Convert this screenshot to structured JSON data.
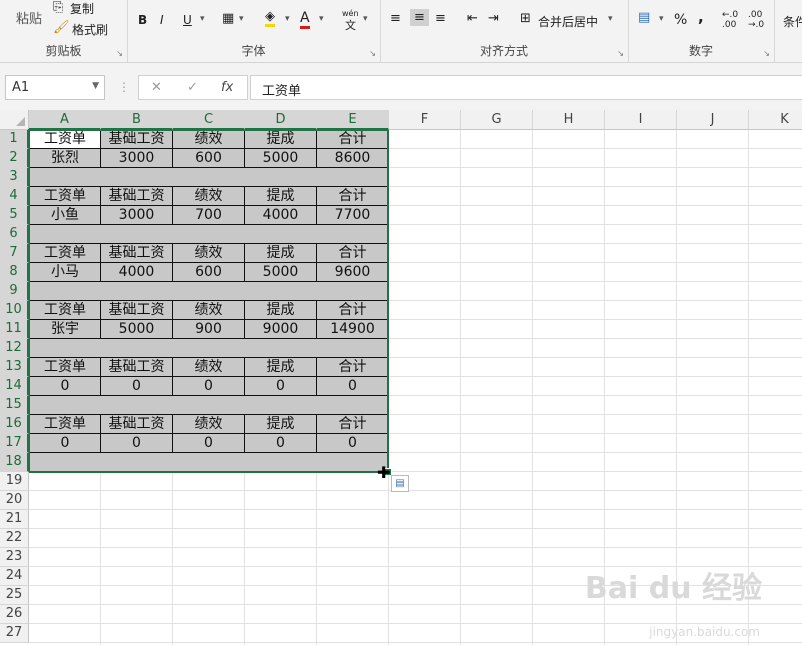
{
  "ribbon": {
    "clipboard": {
      "paste": "粘贴",
      "copy": "复制",
      "format_painter": "格式刷",
      "label": "剪贴板"
    },
    "font": {
      "bold": "B",
      "italic": "I",
      "underline": "U",
      "font_color": "A",
      "wen": "wén",
      "wen_char": "文",
      "label": "字体"
    },
    "alignment": {
      "merge_center": "合并后居中",
      "label": "对齐方式"
    },
    "number": {
      "percent": "%",
      "comma": ",",
      "label": "数字"
    },
    "styles": {
      "cond_format": "条件"
    }
  },
  "formula_bar": {
    "name_box": "A1",
    "cancel": "✕",
    "confirm": "✓",
    "fx": "fx",
    "content": "工资单"
  },
  "columns": [
    "A",
    "B",
    "C",
    "D",
    "E",
    "F",
    "G",
    "H",
    "I",
    "J",
    "K"
  ],
  "rows": [
    "1",
    "2",
    "3",
    "4",
    "5",
    "6",
    "7",
    "8",
    "9",
    "10",
    "11",
    "12",
    "13",
    "14",
    "15",
    "16",
    "17",
    "18",
    "19",
    "20",
    "21",
    "22",
    "23",
    "24",
    "25",
    "26",
    "27"
  ],
  "cells": {
    "r1": [
      "工资单",
      "基础工资",
      "绩效",
      "提成",
      "合计"
    ],
    "r2": [
      "张烈",
      "3000",
      "600",
      "5000",
      "8600"
    ],
    "r4": [
      "工资单",
      "基础工资",
      "绩效",
      "提成",
      "合计"
    ],
    "r5": [
      "小鱼",
      "3000",
      "700",
      "4000",
      "7700"
    ],
    "r7": [
      "工资单",
      "基础工资",
      "绩效",
      "提成",
      "合计"
    ],
    "r8": [
      "小马",
      "4000",
      "600",
      "5000",
      "9600"
    ],
    "r10": [
      "工资单",
      "基础工资",
      "绩效",
      "提成",
      "合计"
    ],
    "r11": [
      "张宇",
      "5000",
      "900",
      "9000",
      "14900"
    ],
    "r13": [
      "工资单",
      "基础工资",
      "绩效",
      "提成",
      "合计"
    ],
    "r14": [
      "0",
      "0",
      "0",
      "0",
      "0"
    ],
    "r16": [
      "工资单",
      "基础工资",
      "绩效",
      "提成",
      "合计"
    ],
    "r17": [
      "0",
      "0",
      "0",
      "0",
      "0"
    ]
  },
  "watermark": {
    "brand": "Bai du 经验",
    "url": "jingyan.baidu.com"
  }
}
